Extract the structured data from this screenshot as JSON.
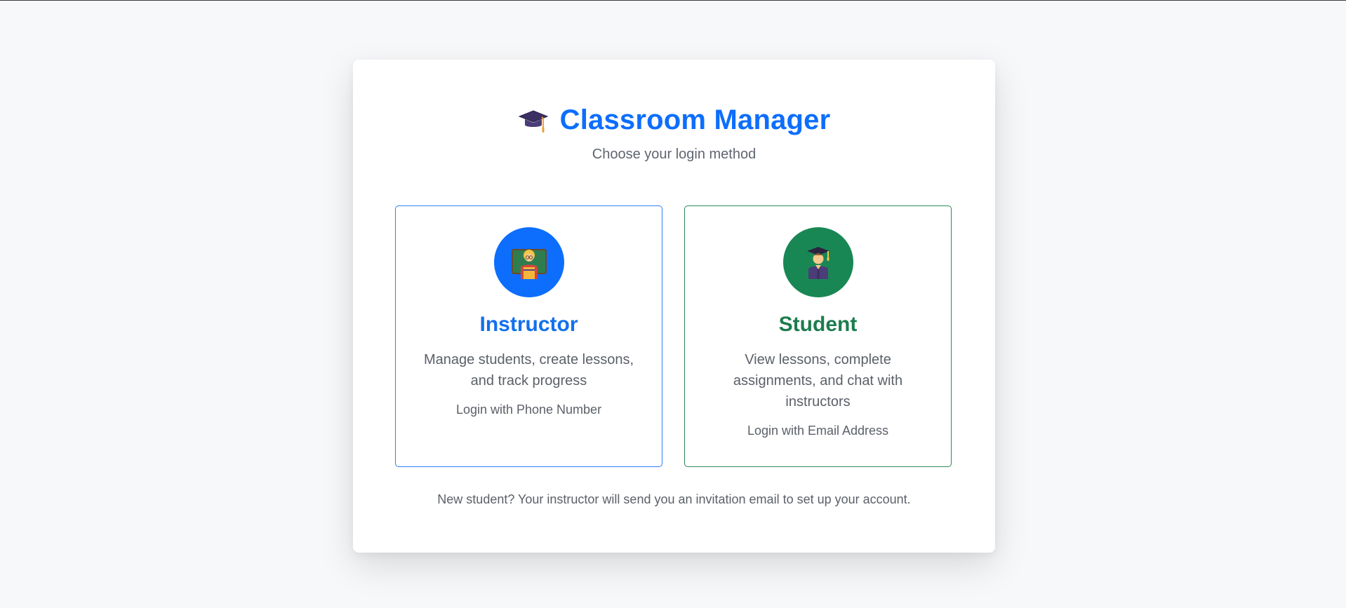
{
  "header": {
    "icon": "graduation-cap-icon",
    "title": "Classroom Manager",
    "subtitle": "Choose your login method"
  },
  "options": [
    {
      "role": "Instructor",
      "icon": "teacher-icon",
      "description": "Manage students, create lessons, and track progress",
      "login_label": "Login with Phone Number",
      "accent_color": "#0d6efd"
    },
    {
      "role": "Student",
      "icon": "student-graduate-icon",
      "description": "View lessons, complete assignments, and chat with instructors",
      "login_label": "Login with Email Address",
      "accent_color": "#198754"
    }
  ],
  "footer": {
    "note": "New student? Your instructor will send you an invitation email to set up your account."
  }
}
